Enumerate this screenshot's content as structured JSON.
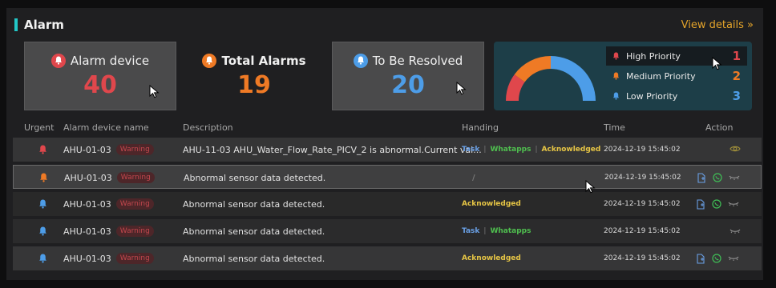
{
  "header": {
    "title": "Alarm",
    "view_details": "View details »"
  },
  "stats": {
    "alarm_device": {
      "label": "Alarm device",
      "value": "40",
      "color": "#e0474c"
    },
    "total_alarms": {
      "label": "Total Alarms",
      "value": "19",
      "color": "#ef7a25"
    },
    "to_be_resolved": {
      "label": "To Be Resolved",
      "value": "20",
      "color": "#4d9de8"
    }
  },
  "priority": {
    "items": [
      {
        "label": "High Priority",
        "value": "1",
        "color": "#e0474c"
      },
      {
        "label": "Medium Priority",
        "value": "2",
        "color": "#ef7a25"
      },
      {
        "label": "Low Priority",
        "value": "3",
        "color": "#4d9de8"
      }
    ],
    "gauge_shares": [
      0.2,
      0.3,
      0.5
    ]
  },
  "table": {
    "columns": [
      "Urgent",
      "Alarm device name",
      "Description",
      "Handing",
      "Time",
      "Action"
    ],
    "rows": [
      {
        "urgent": "high",
        "device": "AHU-01-03",
        "badge": "Warning",
        "description": "AHU-11-03 AHU_Water_Flow_Rate_PICV_2 is abnormal.Current val...",
        "task": "Task",
        "whatapps": "Whatapps",
        "ack": "Acknowledged",
        "slash": "",
        "time": "2024-12-19 15:45:02",
        "actions": "eye"
      },
      {
        "urgent": "medium",
        "device": "AHU-01-03",
        "badge": "Warning",
        "description": "Abnormal sensor data detected.",
        "task": "",
        "whatapps": "",
        "ack": "",
        "slash": "/",
        "time": "2024-12-19 15:45:02",
        "actions": "full"
      },
      {
        "urgent": "low",
        "device": "AHU-01-03",
        "badge": "Warning",
        "description": "Abnormal sensor data detected.",
        "task": "",
        "whatapps": "",
        "ack": "Acknowledged",
        "slash": "",
        "time": "2024-12-19 15:45:02",
        "actions": "full"
      },
      {
        "urgent": "low",
        "device": "AHU-01-03",
        "badge": "Warning",
        "description": "Abnormal sensor data detected.",
        "task": "Task",
        "whatapps": "Whatapps",
        "ack": "",
        "slash": "",
        "time": "2024-12-19 15:45:02",
        "actions": "closed-eye"
      },
      {
        "urgent": "low",
        "device": "AHU-01-03",
        "badge": "Warning",
        "description": "Abnormal sensor data detected.",
        "task": "",
        "whatapps": "",
        "ack": "Acknowledged",
        "slash": "",
        "time": "2024-12-19 15:45:02",
        "actions": "full"
      }
    ]
  }
}
